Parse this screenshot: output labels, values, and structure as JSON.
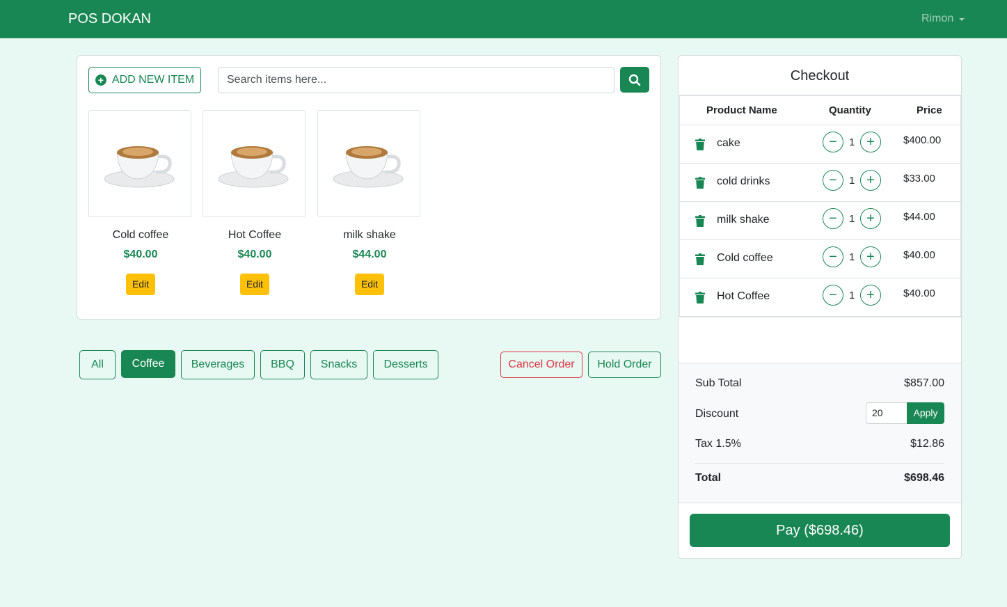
{
  "navbar": {
    "brand": "POS DOKAN",
    "user": "Rimon"
  },
  "toolbar": {
    "add_label": "ADD NEW ITEM",
    "search_placeholder": "Search items here..."
  },
  "products": [
    {
      "name": "Cold coffee",
      "price": "$40.00",
      "edit": "Edit"
    },
    {
      "name": "Hot Coffee",
      "price": "$40.00",
      "edit": "Edit"
    },
    {
      "name": "milk shake",
      "price": "$44.00",
      "edit": "Edit"
    }
  ],
  "categories": [
    "All",
    "Coffee",
    "Beverages",
    "BBQ",
    "Snacks",
    "Desserts"
  ],
  "active_category": "Coffee",
  "order_actions": {
    "cancel": "Cancel Order",
    "hold": "Hold Order"
  },
  "checkout": {
    "title": "Checkout",
    "columns": [
      "Product Name",
      "Quantity",
      "Price"
    ],
    "items": [
      {
        "name": "cake",
        "qty": "1",
        "price": "$400.00"
      },
      {
        "name": "cold drinks",
        "qty": "1",
        "price": "$33.00"
      },
      {
        "name": "milk shake",
        "qty": "1",
        "price": "$44.00"
      },
      {
        "name": "Cold coffee",
        "qty": "1",
        "price": "$40.00"
      },
      {
        "name": "Hot Coffee",
        "qty": "1",
        "price": "$40.00"
      }
    ],
    "subtotal_label": "Sub Total",
    "subtotal": "$857.00",
    "discount_label": "Discount",
    "discount_value": "20",
    "apply_label": "Apply",
    "tax_label": "Tax 1.5%",
    "tax": "$12.86",
    "total_label": "Total",
    "total": "$698.46",
    "pay_label": "Pay ($698.46)"
  },
  "colors": {
    "primary": "#198754",
    "warning": "#ffc107",
    "danger": "#dc3545",
    "background": "#e8f8f2"
  }
}
